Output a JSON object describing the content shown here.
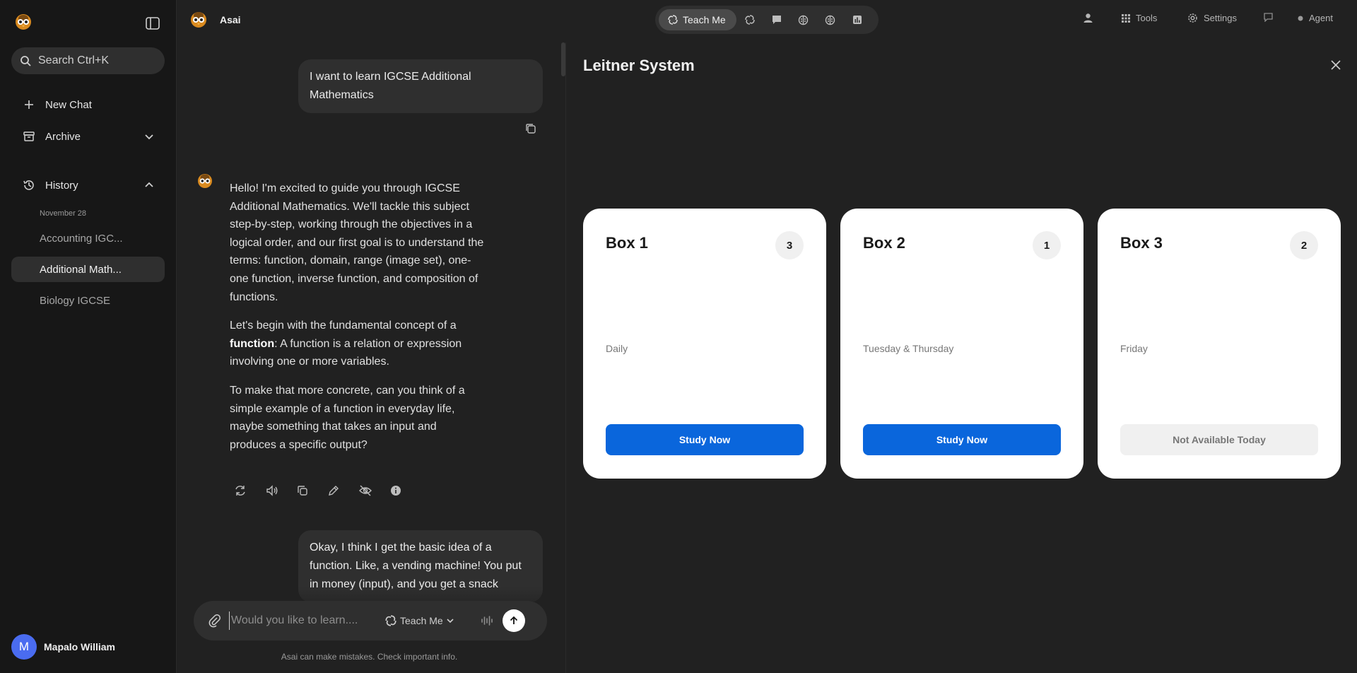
{
  "app": {
    "title": "Asai"
  },
  "sidebar": {
    "search_label": "Search Ctrl+K",
    "new_chat": "New Chat",
    "archive": "Archive",
    "history": "History",
    "history_date": "November 28",
    "history_items": [
      "Accounting IGC...",
      "Additional Math...",
      "Biology IGCSE"
    ],
    "user_initial": "M",
    "user_name": "Mapalo William"
  },
  "topbar": {
    "active_mode": "Teach Me",
    "mode_icons": [
      "swirl-icon",
      "chat-bubble-icon",
      "brain-icon",
      "brain-alt-icon",
      "chart-icon"
    ],
    "tools": "Tools",
    "settings": "Settings",
    "agent": "Agent"
  },
  "chat": {
    "user_msg_1": "I want to learn IGCSE Additional Mathematics",
    "bot_p1": "Hello! I'm excited to guide you through IGCSE Additional Mathematics. We'll tackle this subject step-by-step, working through the objectives in a logical order, and our first goal is to understand the terms: function, domain, range (image set), one-one function, inverse function, and composition of functions.",
    "bot_p2_before": "Let's begin with the fundamental concept of a ",
    "bot_p2_bold": "function",
    "bot_p2_after": ": A function is a relation or expression involving one or more variables.",
    "bot_p3": "To make that more concrete, can you think of a simple example of a function in everyday life, maybe something that takes an input and produces a specific output?",
    "user_msg_2": "Okay, I think I get the basic idea of a function. Like, a vending machine! You put in money (input), and you get a snack",
    "input_placeholder": "Would you like to learn....",
    "input_mode": "Teach Me",
    "disclaimer": "Asai can make mistakes. Check important info."
  },
  "leitner": {
    "title": "Leitner System",
    "boxes": [
      {
        "title": "Box 1",
        "count": "3",
        "schedule": "Daily",
        "button": "Study Now",
        "available": true
      },
      {
        "title": "Box 2",
        "count": "1",
        "schedule": "Tuesday & Thursday",
        "button": "Study Now",
        "available": true
      },
      {
        "title": "Box 3",
        "count": "2",
        "schedule": "Friday",
        "button": "Not Available Today",
        "available": false
      }
    ]
  },
  "colors": {
    "primary_button": "#0a66dc",
    "avatar": "#4a6cf0",
    "background": "#212121",
    "sidebar": "#171717"
  }
}
